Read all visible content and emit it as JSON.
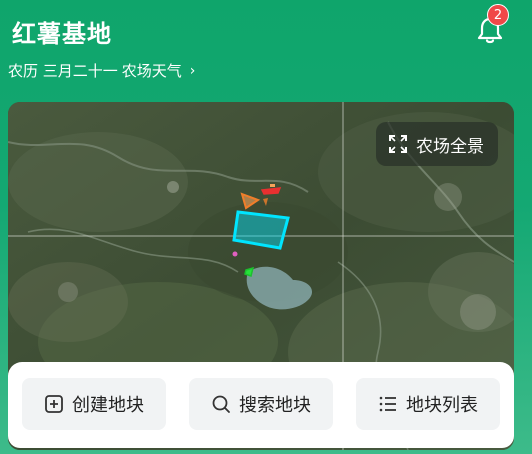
{
  "header": {
    "title": "红薯基地",
    "notification_count": "2"
  },
  "subtitle": {
    "lunar_date": "农历 三月二十一",
    "weather_link": "农场天气",
    "chevron": "›"
  },
  "map": {
    "panorama_button": "农场全景",
    "panorama_icon": "expand-icon"
  },
  "actions": [
    {
      "label": "创建地块",
      "icon": "plus-square-icon"
    },
    {
      "label": "搜索地块",
      "icon": "search-icon"
    },
    {
      "label": "地块列表",
      "icon": "list-icon"
    }
  ],
  "colors": {
    "header_bg": "#0fa56b",
    "badge": "#f04848",
    "parcel_outline": "#00e5ff",
    "action_bg": "#f1f3f4"
  }
}
